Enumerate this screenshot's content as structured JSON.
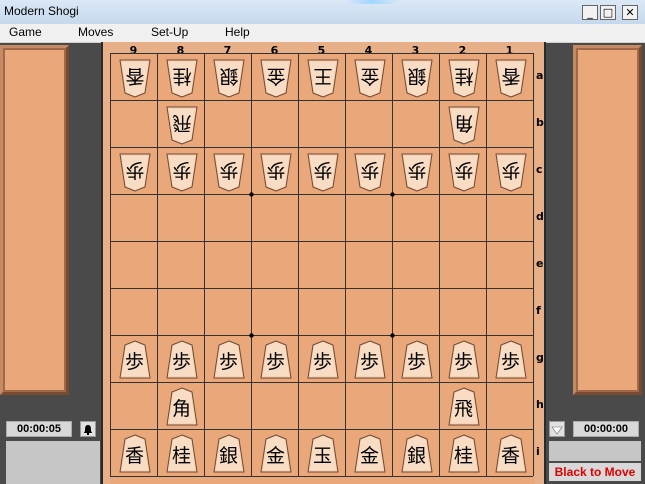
{
  "window": {
    "title": "Modern Shogi",
    "controls": [
      "_",
      "□",
      "✕"
    ]
  },
  "menu": [
    "Game",
    "Moves",
    "Set-Up",
    "Help"
  ],
  "files": [
    "9",
    "8",
    "7",
    "6",
    "5",
    "4",
    "3",
    "2",
    "1"
  ],
  "ranks": [
    "a",
    "b",
    "c",
    "d",
    "e",
    "f",
    "g",
    "h",
    "i"
  ],
  "clocks": {
    "left": "00:00:05",
    "right": "00:00:00"
  },
  "status": "Black to Move",
  "pieces": [
    {
      "k": "香",
      "f": 9,
      "r": 1,
      "gote": true
    },
    {
      "k": "桂",
      "f": 8,
      "r": 1,
      "gote": true
    },
    {
      "k": "銀",
      "f": 7,
      "r": 1,
      "gote": true
    },
    {
      "k": "金",
      "f": 6,
      "r": 1,
      "gote": true
    },
    {
      "k": "王",
      "f": 5,
      "r": 1,
      "gote": true
    },
    {
      "k": "金",
      "f": 4,
      "r": 1,
      "gote": true
    },
    {
      "k": "銀",
      "f": 3,
      "r": 1,
      "gote": true
    },
    {
      "k": "桂",
      "f": 2,
      "r": 1,
      "gote": true
    },
    {
      "k": "香",
      "f": 1,
      "r": 1,
      "gote": true
    },
    {
      "k": "飛",
      "f": 8,
      "r": 2,
      "gote": true
    },
    {
      "k": "角",
      "f": 2,
      "r": 2,
      "gote": true
    },
    {
      "k": "歩",
      "f": 9,
      "r": 3,
      "gote": true
    },
    {
      "k": "歩",
      "f": 8,
      "r": 3,
      "gote": true
    },
    {
      "k": "歩",
      "f": 7,
      "r": 3,
      "gote": true
    },
    {
      "k": "歩",
      "f": 6,
      "r": 3,
      "gote": true
    },
    {
      "k": "歩",
      "f": 5,
      "r": 3,
      "gote": true
    },
    {
      "k": "歩",
      "f": 4,
      "r": 3,
      "gote": true
    },
    {
      "k": "歩",
      "f": 3,
      "r": 3,
      "gote": true
    },
    {
      "k": "歩",
      "f": 2,
      "r": 3,
      "gote": true
    },
    {
      "k": "歩",
      "f": 1,
      "r": 3,
      "gote": true
    },
    {
      "k": "歩",
      "f": 9,
      "r": 7,
      "gote": false
    },
    {
      "k": "歩",
      "f": 8,
      "r": 7,
      "gote": false
    },
    {
      "k": "歩",
      "f": 7,
      "r": 7,
      "gote": false
    },
    {
      "k": "歩",
      "f": 6,
      "r": 7,
      "gote": false
    },
    {
      "k": "歩",
      "f": 5,
      "r": 7,
      "gote": false
    },
    {
      "k": "歩",
      "f": 4,
      "r": 7,
      "gote": false
    },
    {
      "k": "歩",
      "f": 3,
      "r": 7,
      "gote": false
    },
    {
      "k": "歩",
      "f": 2,
      "r": 7,
      "gote": false
    },
    {
      "k": "歩",
      "f": 1,
      "r": 7,
      "gote": false
    },
    {
      "k": "角",
      "f": 8,
      "r": 8,
      "gote": false
    },
    {
      "k": "飛",
      "f": 2,
      "r": 8,
      "gote": false
    },
    {
      "k": "香",
      "f": 9,
      "r": 9,
      "gote": false
    },
    {
      "k": "桂",
      "f": 8,
      "r": 9,
      "gote": false
    },
    {
      "k": "銀",
      "f": 7,
      "r": 9,
      "gote": false
    },
    {
      "k": "金",
      "f": 6,
      "r": 9,
      "gote": false
    },
    {
      "k": "玉",
      "f": 5,
      "r": 9,
      "gote": false
    },
    {
      "k": "金",
      "f": 4,
      "r": 9,
      "gote": false
    },
    {
      "k": "銀",
      "f": 3,
      "r": 9,
      "gote": false
    },
    {
      "k": "桂",
      "f": 2,
      "r": 9,
      "gote": false
    },
    {
      "k": "香",
      "f": 1,
      "r": 9,
      "gote": false
    }
  ]
}
